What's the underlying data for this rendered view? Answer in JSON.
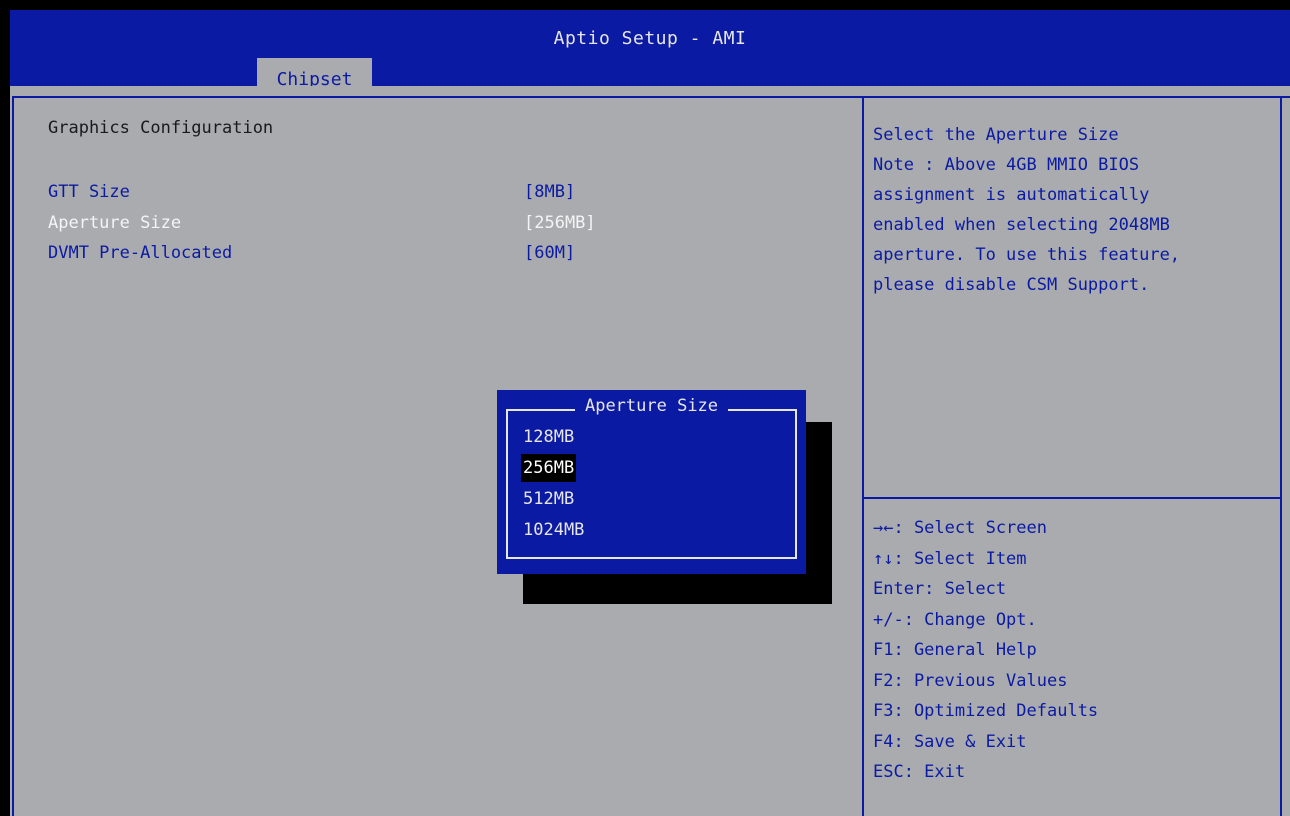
{
  "header": {
    "title": "Aptio Setup - AMI",
    "tabs": [
      {
        "label": "Chipset",
        "active": true
      }
    ]
  },
  "main": {
    "section_title": "Graphics Configuration",
    "settings": [
      {
        "label": "GTT Size",
        "value": "[8MB]",
        "selected": false
      },
      {
        "label": "Aperture Size",
        "value": "[256MB]",
        "selected": true
      },
      {
        "label": "DVMT Pre-Allocated",
        "value": "[60M]",
        "selected": false
      }
    ]
  },
  "popup": {
    "title": "Aperture Size",
    "options": [
      "128MB",
      "256MB",
      "512MB",
      "1024MB"
    ],
    "selected": "256MB"
  },
  "help": {
    "lines": [
      "Select the Aperture Size",
      "Note : Above 4GB MMIO BIOS",
      "assignment is automatically",
      "enabled when selecting 2048MB",
      "aperture. To use this feature,",
      "please disable CSM Support."
    ]
  },
  "keys": {
    "lines": [
      "→←: Select Screen",
      "↑↓: Select Item",
      "Enter: Select",
      "+/-: Change Opt.",
      "F1: General Help",
      "F2: Previous Values",
      "F3: Optimized Defaults",
      "F4: Save & Exit",
      "ESC: Exit"
    ]
  },
  "colors": {
    "header_blue": "#0b1aa3",
    "panel_gray": "#a9abae",
    "selected_text": "#f4f4f4",
    "popup_highlight": "#000000"
  }
}
